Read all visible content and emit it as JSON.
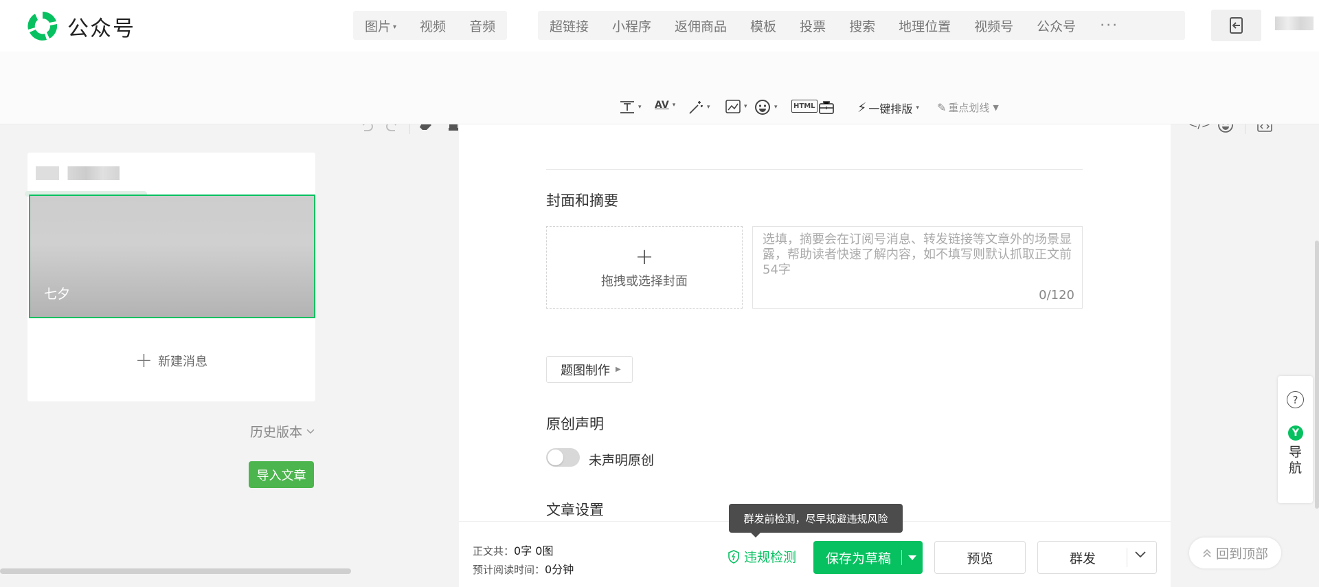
{
  "app": {
    "name": "公众号"
  },
  "insert_toolbar": {
    "media": [
      {
        "label": "图片",
        "dropdown": true
      },
      {
        "label": "视频"
      },
      {
        "label": "音频"
      }
    ],
    "widgets": [
      {
        "label": "超链接"
      },
      {
        "label": "小程序"
      },
      {
        "label": "返佣商品"
      },
      {
        "label": "模板"
      },
      {
        "label": "投票"
      },
      {
        "label": "搜索"
      },
      {
        "label": "地理位置"
      },
      {
        "label": "视频号"
      },
      {
        "label": "公众号"
      }
    ],
    "more_icon": "more-dots-icon"
  },
  "format_toolbar": {
    "font_size": "17px",
    "font_family": "字体",
    "one_click_layout": "一键排版",
    "highlight": "重点划线",
    "html_label": "HTML"
  },
  "left_panel": {
    "article_cover_title": "七夕",
    "new_message": "新建消息",
    "history": "历史版本",
    "import": "导入文章"
  },
  "editor": {
    "cover_section_title": "封面和摘要",
    "cover_upload": "拖拽或选择封面",
    "summary_placeholder": "选填，摘要会在订阅号消息、转发链接等文章外的场景显露，帮助读者快速了解内容，如不填写则默认抓取正文前54字",
    "summary_count": "0/120",
    "title_image_button": "题图制作",
    "original_title": "原创声明",
    "original_status": "未声明原创",
    "original_enabled": false,
    "article_settings_title": "文章设置"
  },
  "bottom_bar": {
    "word_count_label": "正文共：",
    "word_count_value": "0字 0图",
    "read_time_label": "预计阅读时间：",
    "read_time_value": "0分钟",
    "tooltip": "群发前检测，尽早规避违规风险",
    "check": "违规检测",
    "save_draft": "保存为草稿",
    "preview": "预览",
    "mass_send": "群发"
  },
  "right_panel": {
    "help": "?",
    "nav_badge": "Y",
    "nav_label": "导航",
    "back_to_top": "回到顶部"
  },
  "colors": {
    "brand": "#07c160",
    "import_button": "#4cb54d",
    "tooltip": "#4c4c4c"
  }
}
